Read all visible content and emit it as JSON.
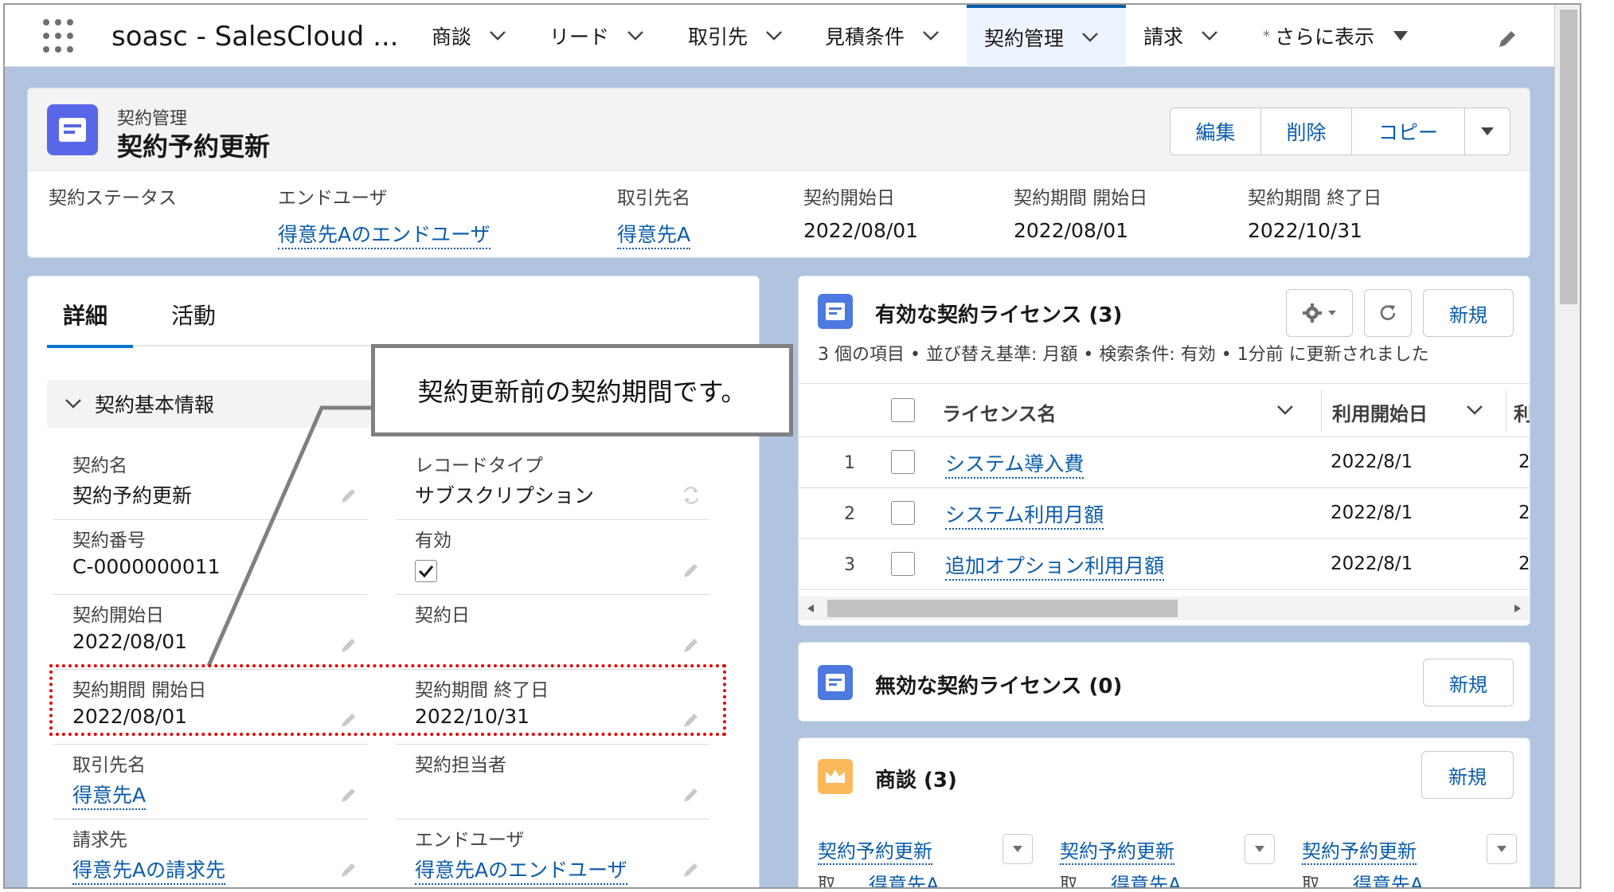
{
  "nav": {
    "app_name": "soasc - SalesCloud ...",
    "tabs": [
      {
        "label": "商談"
      },
      {
        "label": "リード"
      },
      {
        "label": "取引先"
      },
      {
        "label": "見積条件"
      },
      {
        "label": "契約管理"
      },
      {
        "label": "請求"
      },
      {
        "label": "さらに表示",
        "prefix": "*"
      }
    ],
    "active_tab": "契約管理"
  },
  "record": {
    "object_label": "契約管理",
    "title": "契約予約更新",
    "actions": [
      "編集",
      "削除",
      "コピー"
    ],
    "highlights": [
      {
        "label": "契約ステータス",
        "value": ""
      },
      {
        "label": "エンドユーザ",
        "value": "得意先Aのエンドユーザ"
      },
      {
        "label": "取引先名",
        "value": "得意先A"
      },
      {
        "label": "契約開始日",
        "value": "2022/08/01"
      },
      {
        "label": "契約期間 開始日",
        "value": "2022/08/01"
      },
      {
        "label": "契約期間 終了日",
        "value": "2022/10/31"
      }
    ]
  },
  "detail": {
    "tabs": [
      "詳細",
      "活動"
    ],
    "section": "契約基本情報",
    "fields": [
      {
        "label": "契約名",
        "value": "契約予約更新"
      },
      {
        "label": "レコードタイプ",
        "value": "サブスクリプション"
      },
      {
        "label": "契約番号",
        "value": "C-0000000011"
      },
      {
        "label": "有効",
        "value": ""
      },
      {
        "label": "契約開始日",
        "value": "2022/08/01"
      },
      {
        "label": "契約日",
        "value": ""
      },
      {
        "label": "契約期間 開始日",
        "value": "2022/08/01"
      },
      {
        "label": "契約期間 終了日",
        "value": "2022/10/31"
      },
      {
        "label": "取引先名",
        "value": "得意先A"
      },
      {
        "label": "契約担当者",
        "value": ""
      },
      {
        "label": "請求先",
        "value": "得意先Aの請求先"
      },
      {
        "label": "エンドユーザ",
        "value": "得意先Aのエンドユーザ"
      }
    ],
    "active_checked": true
  },
  "callout": {
    "text": "契約更新前の契約期間です。"
  },
  "active_licenses": {
    "title": "有効な契約ライセンス (3)",
    "new_label": "新規",
    "list_info": "3 個の項目 • 並び替え基準: 月額 • 検索条件: 有効 • 1分前 に更新されました",
    "columns": [
      "ライセンス名",
      "利用開始日"
    ],
    "rows": [
      {
        "num": "1",
        "name": "システム導入費",
        "start": "2022/8/1",
        "extra": "2"
      },
      {
        "num": "2",
        "name": "システム利用月額",
        "start": "2022/8/1",
        "extra": "2"
      },
      {
        "num": "3",
        "name": "追加オプション利用月額",
        "start": "2022/8/1",
        "extra": "2"
      }
    ],
    "cut_header": "利"
  },
  "inactive_licenses": {
    "title": "無効な契約ライセンス (0)",
    "new_label": "新規"
  },
  "opportunities": {
    "title": "商談 (3)",
    "new_label": "新規",
    "items": [
      {
        "name": "契約予約更新",
        "sub_label": "取...",
        "account": "得意先A"
      },
      {
        "name": "契約予約更新",
        "sub_label": "取...",
        "account": "得意先A"
      },
      {
        "name": "契約予約更新",
        "sub_label": "取...",
        "account": "得意先A"
      }
    ]
  },
  "colors": {
    "brand_blue": "#0b5cab",
    "record_icon": "#5867e8",
    "list_icon": "#4d79e0",
    "opp_icon": "#fcb95b",
    "highlight_red": "#e00000",
    "page_bg": "#b0c4df"
  },
  "icons": {
    "app_launcher": "waffle-icon",
    "nav_edit": "pencil-icon",
    "settings": "gear-icon",
    "refresh": "refresh-icon"
  }
}
